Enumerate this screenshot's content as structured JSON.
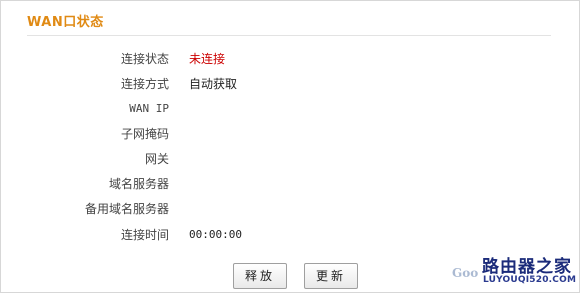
{
  "section": {
    "title": "WAN口状态"
  },
  "rows": [
    {
      "label": "连接状态",
      "value": "未连接"
    },
    {
      "label": "连接方式",
      "value": "自动获取"
    },
    {
      "label": "WAN IP",
      "value": ""
    },
    {
      "label": "子网掩码",
      "value": ""
    },
    {
      "label": "网关",
      "value": ""
    },
    {
      "label": "域名服务器",
      "value": ""
    },
    {
      "label": "备用域名服务器",
      "value": ""
    },
    {
      "label": "连接时间",
      "value": "00:00:00"
    }
  ],
  "buttons": {
    "release": "释放",
    "renew": "更新"
  },
  "watermark": {
    "prefix": "Goo",
    "name": "路由器之家",
    "url": "LUYOUQI520.COM"
  },
  "colors": {
    "title": "#e08a14",
    "status_disconnected": "#cc0000"
  }
}
